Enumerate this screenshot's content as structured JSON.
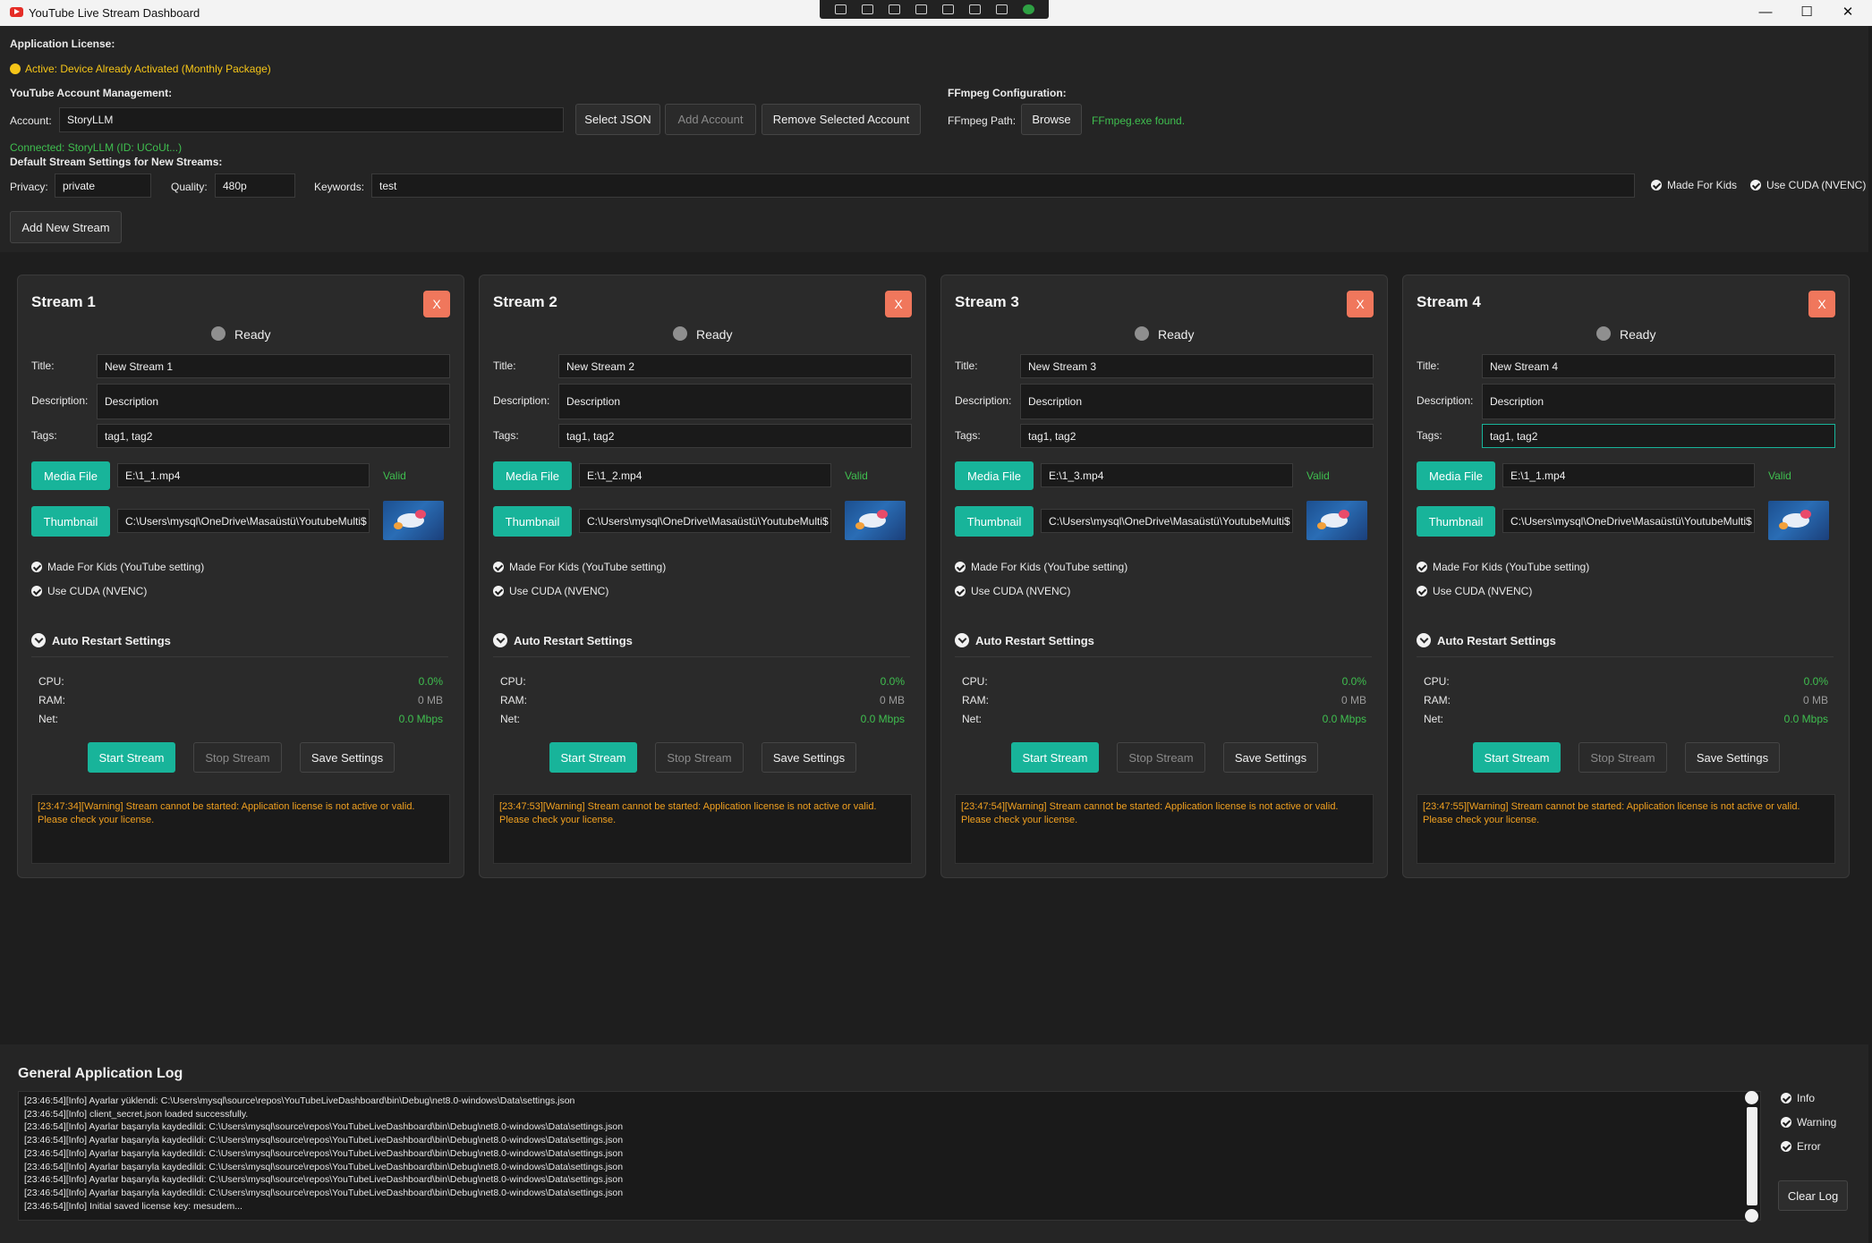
{
  "window": {
    "title": "YouTube Live Stream Dashboard",
    "minimize": "—",
    "maximize": "☐",
    "close": "✕"
  },
  "license": {
    "heading": "Application License:",
    "status": "Active: Device Already Activated (Monthly Package)"
  },
  "account": {
    "heading": "YouTube Account Management:",
    "label": "Account:",
    "value": "StoryLLM",
    "select_json": "Select JSON",
    "add_account": "Add Account",
    "remove_account": "Remove Selected Account",
    "connected": "Connected: StoryLLM (ID: UCoUt...)"
  },
  "ffmpeg": {
    "heading": "FFmpeg Configuration:",
    "label": "FFmpeg Path:",
    "browse": "Browse",
    "status": "FFmpeg.exe found."
  },
  "defaults": {
    "heading": "Default Stream Settings for New Streams:",
    "privacy_label": "Privacy:",
    "privacy": "private",
    "quality_label": "Quality:",
    "quality": "480p",
    "keywords_label": "Keywords:",
    "keywords": "test",
    "made_for_kids": "Made For Kids",
    "use_cuda": "Use CUDA (NVENC)",
    "add_stream": "Add New Stream"
  },
  "card_labels": {
    "close": "X",
    "title": "Title:",
    "description": "Description:",
    "tags": "Tags:",
    "media_file": "Media File",
    "thumbnail": "Thumbnail",
    "made_for_kids": "Made For Kids (YouTube setting)",
    "use_cuda": "Use CUDA (NVENC)",
    "auto_restart": "Auto Restart Settings",
    "cpu": "CPU:",
    "ram": "RAM:",
    "net": "Net:",
    "start": "Start Stream",
    "stop": "Stop Stream",
    "save": "Save Settings"
  },
  "streams": [
    {
      "name": "Stream 1",
      "status": "Ready",
      "title": "New Stream 1",
      "description": "Description",
      "tags": "tag1, tag2",
      "media": "E:\\1_1.mp4",
      "media_status": "Valid",
      "thumbnail": "C:\\Users\\mysql\\OneDrive\\Masaüstü\\YoutubeMulti$",
      "cpu": "0.0%",
      "ram": "0 MB",
      "net": "0.0 Mbps",
      "log": "[23:47:34][Warning] Stream cannot be started: Application license is not active or valid. Please check your license."
    },
    {
      "name": "Stream 2",
      "status": "Ready",
      "title": "New Stream 2",
      "description": "Description",
      "tags": "tag1, tag2",
      "media": "E:\\1_2.mp4",
      "media_status": "Valid",
      "thumbnail": "C:\\Users\\mysql\\OneDrive\\Masaüstü\\YoutubeMulti$",
      "cpu": "0.0%",
      "ram": "0 MB",
      "net": "0.0 Mbps",
      "log": "[23:47:53][Warning] Stream cannot be started: Application license is not active or valid. Please check your license."
    },
    {
      "name": "Stream 3",
      "status": "Ready",
      "title": "New Stream 3",
      "description": "Description",
      "tags": "tag1, tag2",
      "media": "E:\\1_3.mp4",
      "media_status": "Valid",
      "thumbnail": "C:\\Users\\mysql\\OneDrive\\Masaüstü\\YoutubeMulti$",
      "cpu": "0.0%",
      "ram": "0 MB",
      "net": "0.0 Mbps",
      "log": "[23:47:54][Warning] Stream cannot be started: Application license is not active or valid. Please check your license."
    },
    {
      "name": "Stream 4",
      "status": "Ready",
      "title": "New Stream 4",
      "description": "Description",
      "tags": "tag1, tag2",
      "media": "E:\\1_1.mp4",
      "media_status": "Valid",
      "thumbnail": "C:\\Users\\mysql\\OneDrive\\Masaüstü\\YoutubeMulti$",
      "cpu": "0.0%",
      "ram": "0 MB",
      "net": "0.0 Mbps",
      "log": "[23:47:55][Warning] Stream cannot be started: Application license is not active or valid. Please check your license."
    }
  ],
  "general_log": {
    "title": "General Application Log",
    "lines": [
      "[23:46:54][Info] Ayarlar yüklendi: C:\\Users\\mysql\\source\\repos\\YouTubeLiveDashboard\\bin\\Debug\\net8.0-windows\\Data\\settings.json",
      "[23:46:54][Info] client_secret.json loaded successfully.",
      "[23:46:54][Info] Ayarlar başarıyla kaydedildi: C:\\Users\\mysql\\source\\repos\\YouTubeLiveDashboard\\bin\\Debug\\net8.0-windows\\Data\\settings.json",
      "[23:46:54][Info] Ayarlar başarıyla kaydedildi: C:\\Users\\mysql\\source\\repos\\YouTubeLiveDashboard\\bin\\Debug\\net8.0-windows\\Data\\settings.json",
      "[23:46:54][Info] Ayarlar başarıyla kaydedildi: C:\\Users\\mysql\\source\\repos\\YouTubeLiveDashboard\\bin\\Debug\\net8.0-windows\\Data\\settings.json",
      "[23:46:54][Info] Ayarlar başarıyla kaydedildi: C:\\Users\\mysql\\source\\repos\\YouTubeLiveDashboard\\bin\\Debug\\net8.0-windows\\Data\\settings.json",
      "[23:46:54][Info] Ayarlar başarıyla kaydedildi: C:\\Users\\mysql\\source\\repos\\YouTubeLiveDashboard\\bin\\Debug\\net8.0-windows\\Data\\settings.json",
      "[23:46:54][Info] Ayarlar başarıyla kaydedildi: C:\\Users\\mysql\\source\\repos\\YouTubeLiveDashboard\\bin\\Debug\\net8.0-windows\\Data\\settings.json",
      "[23:46:54][Info] Initial saved license key: mesudem..."
    ],
    "filter_info": "Info",
    "filter_warning": "Warning",
    "filter_error": "Error",
    "clear_log": "Clear Log"
  },
  "colors": {
    "accent": "#18b49a",
    "warning": "#f0a020",
    "license": "#f5c518",
    "success": "#3fbf4f",
    "close": "#f0775c"
  }
}
